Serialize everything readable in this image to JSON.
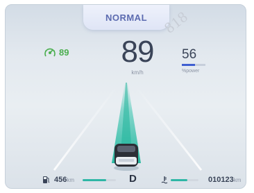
{
  "mode": {
    "label": "NORMAL"
  },
  "watermark": {
    "text": "818"
  },
  "cruise": {
    "icon": "adaptive-cruise-icon",
    "speed": "89",
    "color": "#4caf50"
  },
  "speed": {
    "value": "89",
    "unit": "km/h"
  },
  "power": {
    "value": "56",
    "unit": "%power",
    "level_percent": 56,
    "bar_color": "#3f5fd1"
  },
  "range": {
    "icon": "fuel-pump-icon",
    "value": "456",
    "unit": "km",
    "level_percent": 70
  },
  "gear": {
    "value": "D"
  },
  "temperature": {
    "icon": "thermometer-icon",
    "level_percent": 60
  },
  "odometer": {
    "value": "010123",
    "unit": "km"
  },
  "accent_color": "#2fb6a5"
}
